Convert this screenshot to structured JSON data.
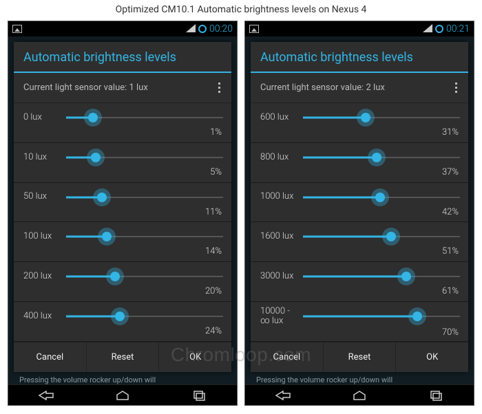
{
  "page_title": "Optimized CM10.1 Automatic brightness levels on Nexus 4",
  "watermark": "Chromloop.com",
  "accent_color": "#33b5e5",
  "below_dialog_text": "Pressing the volume rocker up/down will",
  "screens": [
    {
      "clock": "00:20",
      "status_left_icons": [
        "gallery-icon"
      ],
      "dialog_title": "Automatic brightness levels",
      "sensor_prefix": "Current light sensor value: ",
      "sensor_value": "1 lux",
      "rows": [
        {
          "lux": "0 lux",
          "pct": "1%",
          "pos": 17
        },
        {
          "lux": "10 lux",
          "pct": "5%",
          "pos": 19
        },
        {
          "lux": "50 lux",
          "pct": "11%",
          "pos": 23
        },
        {
          "lux": "100 lux",
          "pct": "14%",
          "pos": 26
        },
        {
          "lux": "200 lux",
          "pct": "20%",
          "pos": 31
        },
        {
          "lux": "400 lux",
          "pct": "24%",
          "pos": 34
        }
      ],
      "buttons": {
        "cancel": "Cancel",
        "reset": "Reset",
        "ok": "OK"
      }
    },
    {
      "clock": "00:21",
      "status_left_icons": [
        "gallery-icon"
      ],
      "dialog_title": "Automatic brightness levels",
      "sensor_prefix": "Current light sensor value: ",
      "sensor_value": "2 lux",
      "rows": [
        {
          "lux": "600 lux",
          "pct": "31%",
          "pos": 40
        },
        {
          "lux": "800 lux",
          "pct": "37%",
          "pos": 47
        },
        {
          "lux": "1000 lux",
          "pct": "42%",
          "pos": 49
        },
        {
          "lux": "1600 lux",
          "pct": "51%",
          "pos": 56
        },
        {
          "lux": "3000 lux",
          "pct": "61%",
          "pos": 66
        },
        {
          "lux": "10000 -\n∞ lux",
          "pct": "70%",
          "pos": 73
        }
      ],
      "buttons": {
        "cancel": "Cancel",
        "reset": "Reset",
        "ok": "OK"
      }
    }
  ]
}
